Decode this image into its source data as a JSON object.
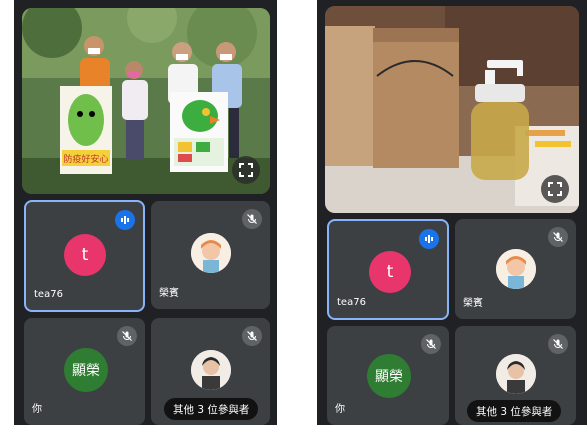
{
  "left_phone": {
    "poster_text": "防疫好安心",
    "tiles": {
      "tea76": {
        "name": "tea76",
        "avatar_letter": "t",
        "mic": "speaking-icon"
      },
      "rong": {
        "name": "榮賓",
        "mic": "mic-off-icon"
      },
      "self": {
        "name": "你",
        "avatar_text": "顯榮",
        "mic": "mic-off-icon"
      },
      "others": {
        "mic": "mic-off-icon",
        "more_label": "其他 3 位參與者"
      }
    }
  },
  "right_phone": {
    "tiles": {
      "tea76": {
        "name": "tea76",
        "avatar_letter": "t",
        "mic": "speaking-icon"
      },
      "rong": {
        "name": "榮賓",
        "mic": "mic-off-icon"
      },
      "self": {
        "name": "你",
        "avatar_text": "顯榮",
        "mic": "mic-off-icon"
      },
      "others": {
        "mic": "mic-off-icon",
        "more_label": "其他 3 位參與者"
      }
    }
  },
  "colors": {
    "background": "#202124",
    "tile": "#3c4043",
    "active_border": "#8ab4f8",
    "speaking_badge": "#1a73e8",
    "letter_avatar": "#e8366d",
    "group_avatar": "#2e7d32"
  }
}
